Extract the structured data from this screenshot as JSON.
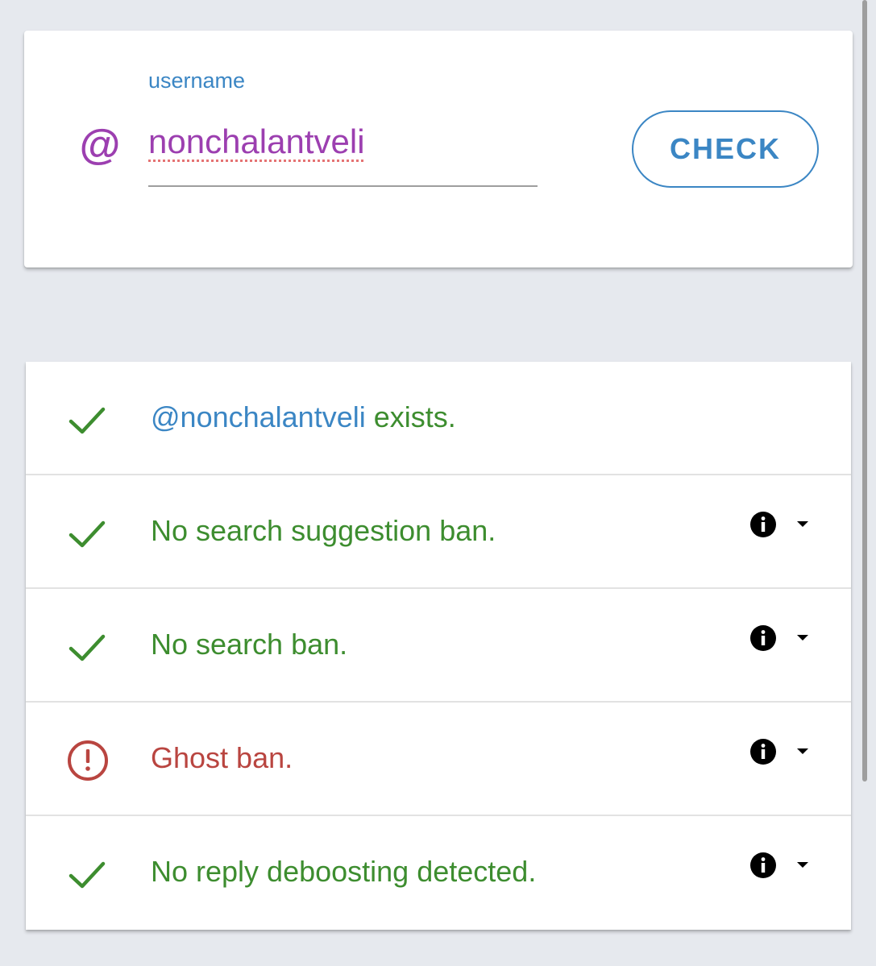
{
  "search": {
    "at_symbol": "@",
    "label": "username",
    "value": "nonchalantveli",
    "check_button": "CHECK"
  },
  "results": [
    {
      "status": "ok",
      "icon": "check-icon",
      "handle": "@nonchalantveli",
      "text": " exists.",
      "has_details": false
    },
    {
      "status": "ok",
      "icon": "check-icon",
      "text": "No search suggestion ban.",
      "has_details": true
    },
    {
      "status": "ok",
      "icon": "check-icon",
      "text": "No search ban.",
      "has_details": true
    },
    {
      "status": "bad",
      "icon": "alert-circle-icon",
      "text": "Ghost ban.",
      "has_details": true
    },
    {
      "status": "ok",
      "icon": "check-icon",
      "text": "No reply deboosting detected.",
      "has_details": true
    }
  ],
  "colors": {
    "background": "#e6e9ee",
    "accent_blue": "#3b86c4",
    "purple": "#9c3fb0",
    "ok_green": "#3d8d2f",
    "bad_red": "#b94540"
  }
}
